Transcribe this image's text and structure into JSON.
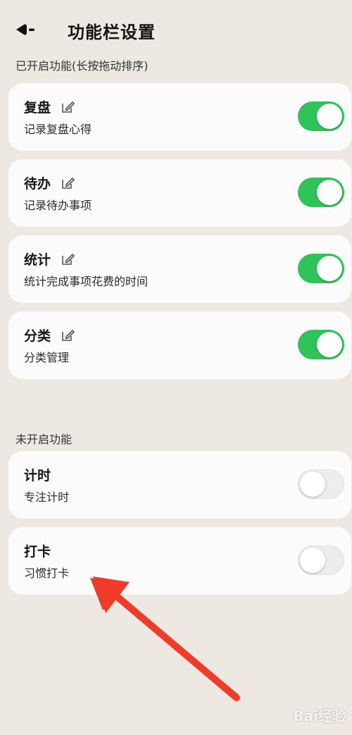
{
  "header": {
    "title": "功能栏设置"
  },
  "enabled_section": {
    "label": "已开启功能(长按拖动排序)",
    "items": [
      {
        "title": "复盘",
        "desc": "记录复盘心得",
        "enabled": true,
        "editable": true
      },
      {
        "title": "待办",
        "desc": "记录待办事项",
        "enabled": true,
        "editable": true
      },
      {
        "title": "统计",
        "desc": "统计完成事项花费的时间",
        "enabled": true,
        "editable": true
      },
      {
        "title": "分类",
        "desc": "分类管理",
        "enabled": true,
        "editable": true
      }
    ]
  },
  "disabled_section": {
    "label": "未开启功能",
    "items": [
      {
        "title": "计时",
        "desc": "专注计时",
        "enabled": false,
        "editable": false
      },
      {
        "title": "打卡",
        "desc": "习惯打卡",
        "enabled": false,
        "editable": false
      }
    ]
  },
  "icons": {
    "back": "back-arrow-icon",
    "edit": "edit-icon"
  },
  "colors": {
    "background": "#ede9e2",
    "card": "#fbfbfb",
    "toggle_on": "#2fc457",
    "toggle_off": "#ededed",
    "annotation_arrow": "#ee3b2a"
  },
  "watermark": {
    "text": "Bai经验"
  }
}
